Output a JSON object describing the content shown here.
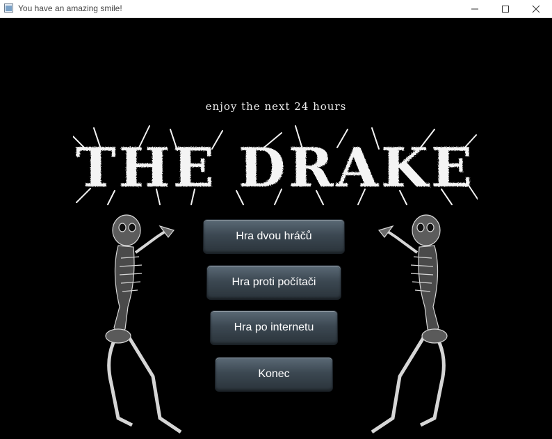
{
  "window": {
    "title": "You have an amazing smile!",
    "controls": [
      "minimize",
      "maximize",
      "close"
    ]
  },
  "header": {
    "tagline": "enjoy the next 24 hours",
    "title": "THE DRAKE"
  },
  "menu": {
    "buttons": [
      {
        "label": "Hra dvou hráčů"
      },
      {
        "label": "Hra proti počítači"
      },
      {
        "label": "Hra po internetu"
      },
      {
        "label": "Konec"
      }
    ]
  },
  "decorations": {
    "left": "praying-skeleton-icon",
    "right": "praying-skeleton-icon"
  },
  "colors": {
    "background": "#000000",
    "button_top": "#5b6a76",
    "button_bottom": "#2a333a",
    "text": "#ffffff"
  }
}
